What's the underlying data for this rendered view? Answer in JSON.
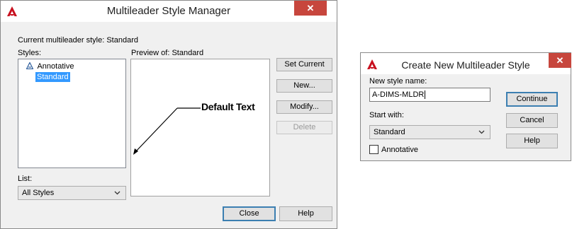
{
  "manager_dialog": {
    "title": "Multileader Style Manager",
    "close_glyph": "✕",
    "current_style_label": "Current multileader style: Standard",
    "styles_label": "Styles:",
    "styles": [
      {
        "label": "Annotative",
        "icon": "annotative-scale-icon"
      },
      {
        "label": "Standard",
        "selected": true
      }
    ],
    "preview_label": "Preview of: Standard",
    "preview_text": "Default Text",
    "list_label": "List:",
    "list_value": "All Styles",
    "buttons": {
      "set_current": "Set Current",
      "new": "New...",
      "modify": "Modify...",
      "delete": "Delete",
      "close": "Close",
      "help": "Help"
    }
  },
  "create_dialog": {
    "title": "Create New Multileader Style",
    "close_glyph": "✕",
    "new_style_name_label": "New style name:",
    "new_style_name_value": "A-DIMS-MLDR",
    "start_with_label": "Start with:",
    "start_with_value": "Standard",
    "annotative_label": "Annotative",
    "annotative_checked": false,
    "buttons": {
      "continue": "Continue",
      "cancel": "Cancel",
      "help": "Help"
    }
  },
  "colors": {
    "close_button": "#c7463d",
    "selection": "#3399ff",
    "app_logo": "#c8101f"
  }
}
